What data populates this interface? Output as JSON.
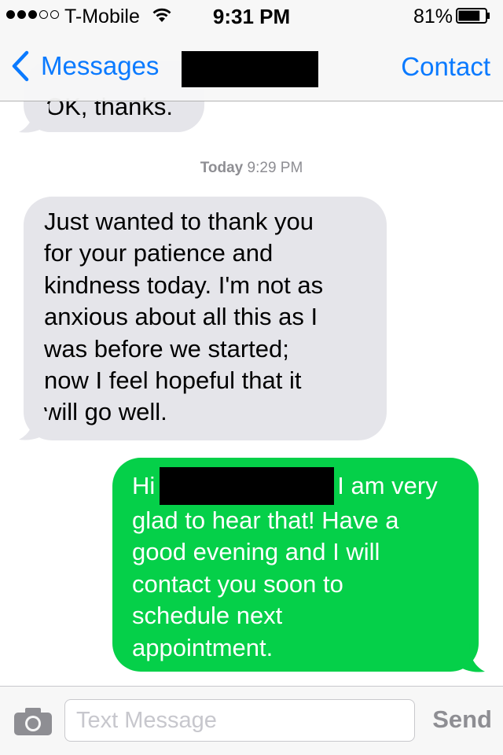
{
  "status_bar": {
    "signal_strength": 3,
    "signal_total": 5,
    "carrier": "T-Mobile",
    "wifi_icon": "wifi-icon",
    "time": "9:31 PM",
    "battery_percent_label": "81%",
    "battery_level": 0.81
  },
  "nav": {
    "back_label": "Messages",
    "back_icon": "chevron-left-icon",
    "contact_label": "Contact",
    "accent_color": "#0a7aff"
  },
  "conversation": {
    "previous_message": "OK, thanks.",
    "timestamp": {
      "day": "Today",
      "time": "9:29 PM"
    },
    "incoming_message": {
      "lines": [
        "Just wanted to thank you",
        "for your patience and",
        "kindness today. I'm not as",
        "anxious about all this as I",
        "was before we started;",
        "now I feel hopeful that it",
        "will go well."
      ],
      "bubble_color": "#e5e5ea"
    },
    "outgoing_message": {
      "greeting": "Hi",
      "first_line_rest": "I am very",
      "lines": [
        "glad to hear that! Have a",
        "good evening and I will",
        "contact you soon to",
        "schedule next",
        "appointment."
      ],
      "bubble_color": "#05d049"
    }
  },
  "input_bar": {
    "camera_icon": "camera-icon",
    "placeholder": "Text Message",
    "value": "",
    "send_label": "Send"
  }
}
